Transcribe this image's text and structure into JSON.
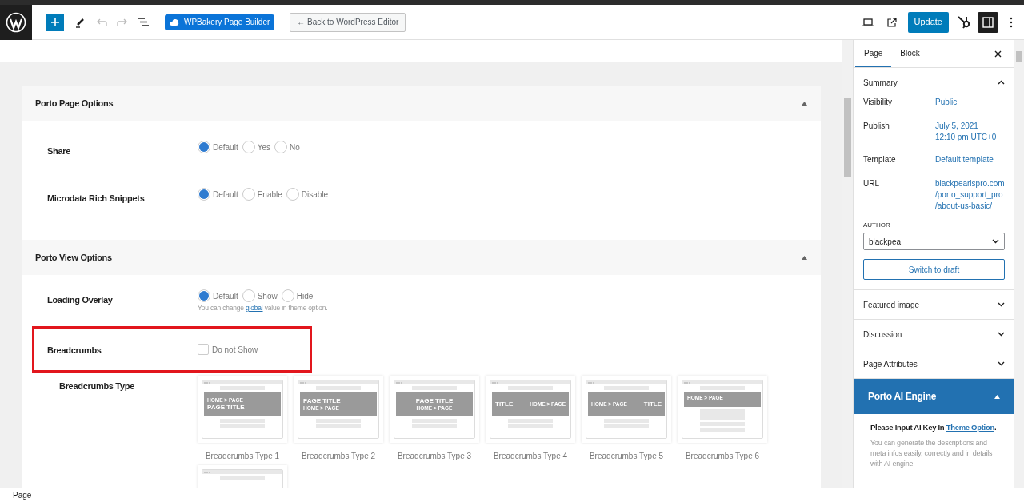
{
  "toolbar": {
    "builder_button": "WPBakery Page Builder",
    "back_button": "← Back to WordPress Editor",
    "update_button": "Update"
  },
  "sections": [
    {
      "title": "Porto Page Options",
      "expanded": true,
      "rows": [
        {
          "label": "Share",
          "kind": "radio",
          "highlight": false,
          "options": [
            {
              "label": "Default",
              "selected": true
            },
            {
              "label": "Yes",
              "selected": false
            },
            {
              "label": "No",
              "selected": false
            }
          ]
        },
        {
          "label": "Microdata Rich Snippets",
          "kind": "radio",
          "highlight": false,
          "options": [
            {
              "label": "Default",
              "selected": true
            },
            {
              "label": "Enable",
              "selected": false
            },
            {
              "label": "Disable",
              "selected": false
            }
          ]
        }
      ]
    },
    {
      "title": "Porto View Options",
      "expanded": true,
      "rows": [
        {
          "label": "Loading Overlay",
          "kind": "radio",
          "highlight": false,
          "options": [
            {
              "label": "Default",
              "selected": true
            },
            {
              "label": "Show",
              "selected": false
            },
            {
              "label": "Hide",
              "selected": false
            }
          ],
          "hint_before": "You can change ",
          "hint_link": "global",
          "hint_after": " value in theme option."
        },
        {
          "label": "Breadcrumbs",
          "kind": "checkbox",
          "highlight": true,
          "checkbox": {
            "label": "Do not Show",
            "checked": false
          }
        },
        {
          "label": "Breadcrumbs Type",
          "kind": "thumbnails",
          "highlight": false,
          "thumbnails": [
            {
              "kind": "left",
              "texts": [
                {
                  "kind": "crumb",
                  "text": "HOME > PAGE"
                },
                {
                  "kind": "title",
                  "text": "PAGE TITLE"
                }
              ],
              "caption": "Breadcrumbs Type 1"
            },
            {
              "kind": "left",
              "texts": [
                {
                  "kind": "title",
                  "text": "PAGE TITLE"
                },
                {
                  "kind": "crumb",
                  "text": "HOME > PAGE"
                }
              ],
              "caption": "Breadcrumbs Type 2"
            },
            {
              "kind": "center",
              "texts": [
                {
                  "kind": "title",
                  "text": "PAGE TITLE"
                },
                {
                  "kind": "crumb",
                  "text": "HOME > PAGE"
                }
              ],
              "caption": "Breadcrumbs Type 3"
            },
            {
              "kind": "split",
              "texts": [
                {
                  "kind": "title",
                  "text": "TITLE"
                },
                {
                  "kind": "crumb",
                  "text": "HOME > PAGE"
                }
              ],
              "caption": "Breadcrumbs Type 4"
            },
            {
              "kind": "split",
              "texts": [
                {
                  "kind": "crumb",
                  "text": "HOME > PAGE"
                },
                {
                  "kind": "title",
                  "text": "TITLE"
                }
              ],
              "caption": "Breadcrumbs Type 5"
            },
            {
              "kind": "top",
              "texts": [
                {
                  "kind": "crumb",
                  "text": "HOME > PAGE"
                }
              ],
              "caption": "Breadcrumbs Type 6"
            },
            {
              "kind": "partial"
            }
          ]
        }
      ]
    }
  ],
  "sidebar": {
    "tabs": [
      {
        "label": "Page",
        "selected": true
      },
      {
        "label": "Block",
        "selected": false
      }
    ],
    "summary": {
      "title": "Summary",
      "expanded": true,
      "fields": [
        {
          "label": "Visibility",
          "value": "Public"
        },
        {
          "label": "Publish",
          "value": "July 5, 2021\n12:10 pm UTC+0"
        },
        {
          "label": "Template",
          "value": "Default template"
        },
        {
          "label": "URL",
          "value": "blackpearlspro.com\n/porto_support_pro\n/about-us-basic/"
        }
      ],
      "author_label": "AUTHOR",
      "author": "blackpea",
      "switch_button": "Switch to draft"
    },
    "panels": [
      {
        "title": "Featured image",
        "expanded": false
      },
      {
        "title": "Discussion",
        "expanded": false
      },
      {
        "title": "Page Attributes",
        "expanded": false
      }
    ],
    "ai_engine": {
      "title": "Porto AI Engine",
      "expanded": true,
      "notice_before": "Please Input AI Key In ",
      "notice_link": "Theme Option",
      "notice_after": ".",
      "description": "You can generate the descriptions and meta infos easily, correctly and in details with AI engine."
    }
  },
  "status_bar": "Page"
}
